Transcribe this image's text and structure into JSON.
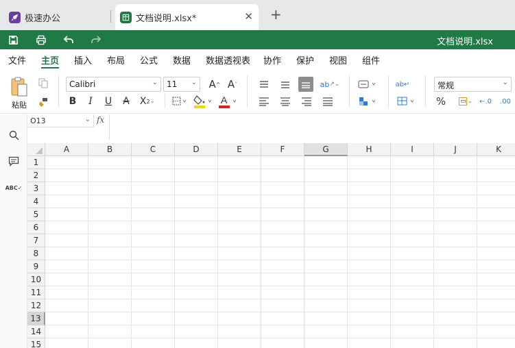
{
  "tabs": [
    {
      "label": "极速办公",
      "icon": "rocket-icon",
      "color": "#6b3fa0"
    },
    {
      "label": "文档说明.xlsx*",
      "icon": "sheet-icon",
      "color": "#1f7a45"
    }
  ],
  "title_bar": {
    "document_title": "文档说明.xlsx"
  },
  "menu": {
    "items": [
      "文件",
      "主页",
      "插入",
      "布局",
      "公式",
      "数据",
      "数据透视表",
      "协作",
      "保护",
      "视图",
      "组件"
    ],
    "active": "主页"
  },
  "ribbon": {
    "paste_label": "粘贴",
    "font_name": "Calibri",
    "font_size": "11",
    "number_format": "常规",
    "colors": {
      "fill": "#f5d800",
      "font": "#e02020"
    }
  },
  "formula_bar": {
    "cell_ref": "O13",
    "fx_label": "fx",
    "value": ""
  },
  "grid": {
    "columns": [
      "A",
      "B",
      "C",
      "D",
      "E",
      "F",
      "G",
      "H",
      "I",
      "J",
      "K"
    ],
    "rows": [
      "1",
      "2",
      "3",
      "4",
      "5",
      "6",
      "7",
      "8",
      "9",
      "10",
      "11",
      "12",
      "13",
      "14",
      "15"
    ],
    "selected_column": "G",
    "selected_row": "13"
  },
  "theme": {
    "accent": "#1f7a45"
  }
}
